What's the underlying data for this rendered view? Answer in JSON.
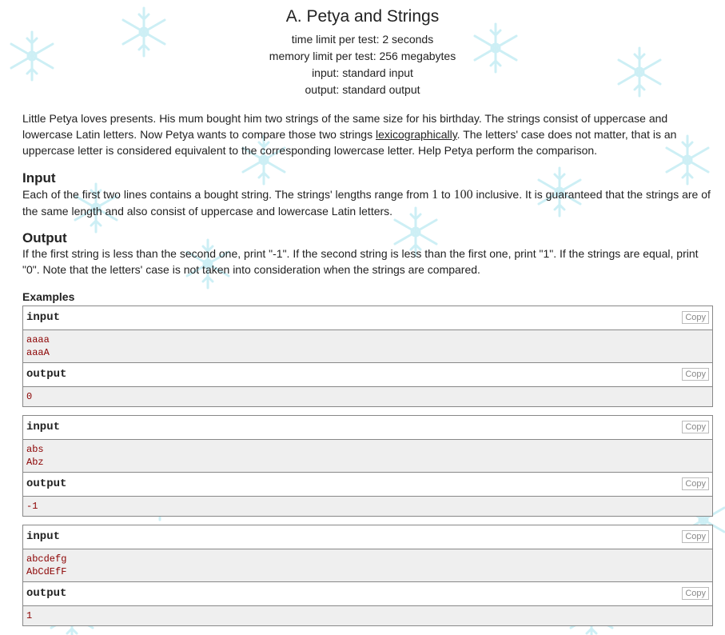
{
  "problem": {
    "title": "A. Petya and Strings",
    "time_limit": "time limit per test: 2 seconds",
    "memory_limit": "memory limit per test: 256 megabytes",
    "input_file": "input: standard input",
    "output_file": "output: standard output"
  },
  "statement": {
    "part1": "Little Petya loves presents. His mum bought him two strings of the same size for his birthday. The strings consist of uppercase and lowercase Latin letters. Now Petya wants to compare those two strings ",
    "link": "lexicographically",
    "part2": ". The letters' case does not matter, that is an uppercase letter is considered equivalent to the corresponding lowercase letter. Help Petya perform the comparison."
  },
  "input_section": {
    "title": "Input",
    "text1": "Each of the first two lines contains a bought string. The strings' lengths range from ",
    "min": "1",
    "text2": " to ",
    "max": "100",
    "text3": " inclusive. It is guaranteed that the strings are of the same length and also consist of uppercase and lowercase Latin letters."
  },
  "output_section": {
    "title": "Output",
    "text": "If the first string is less than the second one, print \"-1\". If the second string is less than the first one, print \"1\". If the strings are equal, print \"0\". Note that the letters' case is not taken into consideration when the strings are compared."
  },
  "examples": {
    "title": "Examples",
    "input_label": "input",
    "output_label": "output",
    "copy_label": "Copy",
    "items": [
      {
        "input": [
          "aaaa",
          "aaaA"
        ],
        "output": [
          "0"
        ]
      },
      {
        "input": [
          "abs",
          "Abz"
        ],
        "output": [
          "-1"
        ]
      },
      {
        "input": [
          "abcdefg",
          "AbCdEfF"
        ],
        "output": [
          "1"
        ]
      }
    ]
  }
}
